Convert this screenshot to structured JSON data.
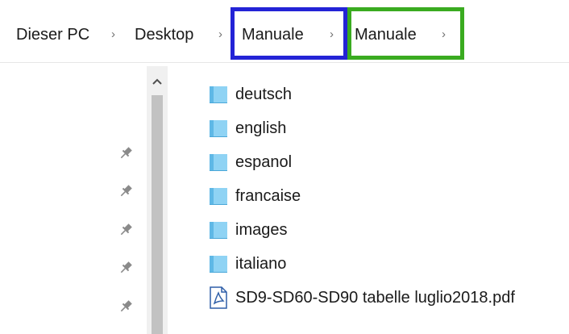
{
  "breadcrumb": {
    "items": [
      {
        "label": "Dieser PC"
      },
      {
        "label": "Desktop"
      },
      {
        "label": "Manuale"
      },
      {
        "label": "Manuale"
      }
    ],
    "separator": "›"
  },
  "highlight_colors": {
    "blue": "#2323d6",
    "green": "#3aab20"
  },
  "nav": {
    "scroll_up_icon": "chevron-up-icon",
    "pin_icon": "pin-icon"
  },
  "files": [
    {
      "name": "deutsch",
      "type": "folder"
    },
    {
      "name": "english",
      "type": "folder"
    },
    {
      "name": "espanol",
      "type": "folder"
    },
    {
      "name": "francaise",
      "type": "folder"
    },
    {
      "name": "images",
      "type": "folder"
    },
    {
      "name": "italiano",
      "type": "folder"
    },
    {
      "name": "SD9-SD60-SD90 tabelle luglio2018.pdf",
      "type": "pdf"
    }
  ]
}
